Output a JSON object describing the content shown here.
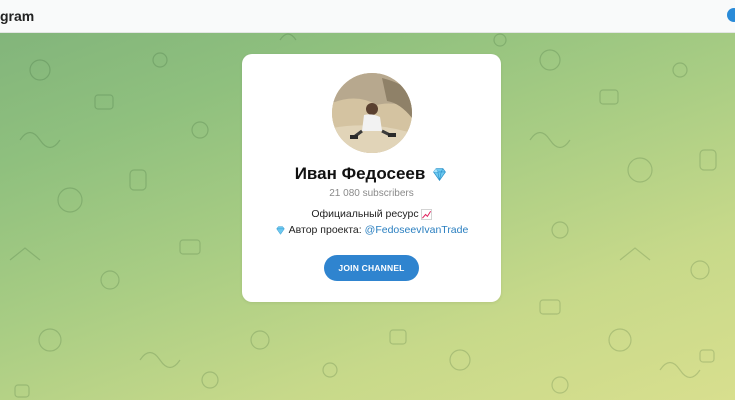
{
  "header": {
    "title": "gram",
    "app_icon": "telegram-logo-icon"
  },
  "channel": {
    "name": "Иван Федосеев",
    "name_badge_icon": "diamond-icon",
    "subscribers": "21 080 subscribers",
    "description_line1": "Официальный ресурс",
    "description_line1_icon": "chart-increasing-icon",
    "description_line2_prefix": "Автор проекта:",
    "description_line2_icon": "diamond-icon",
    "author_link": "@FedoseevIvanTrade"
  },
  "join_button": {
    "label": "JOIN CHANNEL"
  },
  "colors": {
    "accent": "#2f84cf",
    "link": "#2a7fc0",
    "background_top": "#7fb27a",
    "background_bottom": "#d8df8e"
  }
}
